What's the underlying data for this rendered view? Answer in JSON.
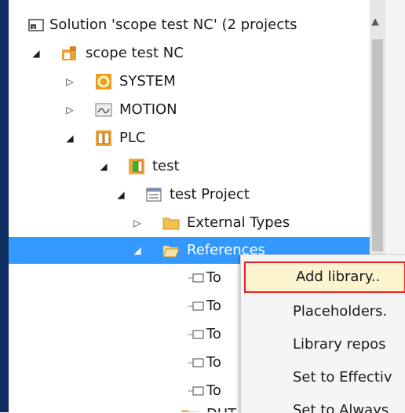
{
  "tree": {
    "solution_label": "Solution 'scope test NC' (2 projects",
    "project_label": "scope test NC",
    "system_label": "SYSTEM",
    "motion_label": "MOTION",
    "plc_label": "PLC",
    "test_label": "test",
    "test_project_label": "test Project",
    "external_types_label": "External Types",
    "references_label": "References",
    "ref_children": [
      "To",
      "To",
      "To",
      "To",
      "To"
    ],
    "dut_label": "DUT"
  },
  "context_menu": {
    "items": [
      "Add library..",
      "Placeholders.",
      "Library repos",
      "Set to Effectiv",
      "Set to Always"
    ]
  },
  "colors": {
    "selection": "#3399ff",
    "highlight_bg": "#fcf3cf",
    "highlight_border": "#e8212a"
  }
}
